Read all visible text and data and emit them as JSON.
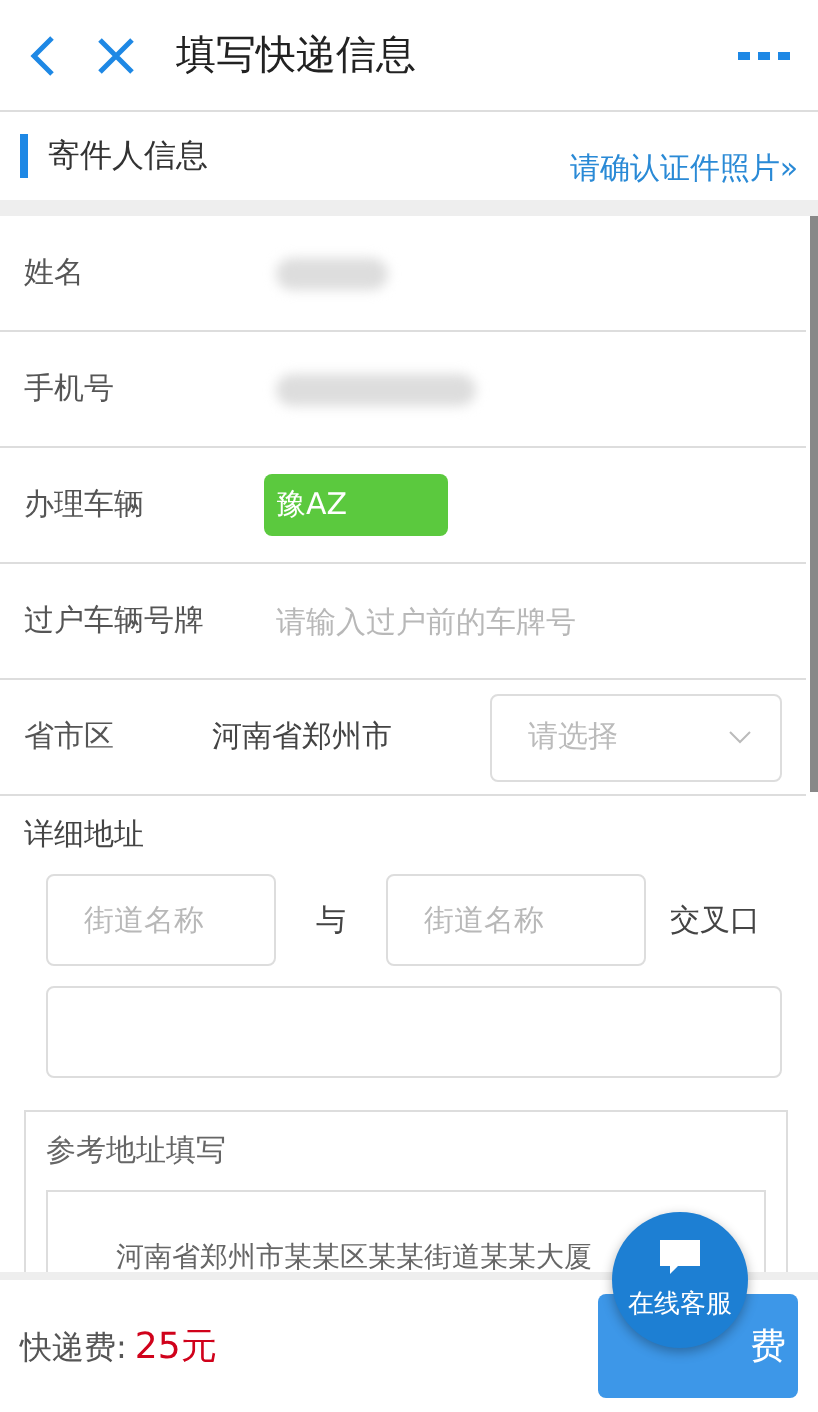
{
  "header": {
    "title": "填写快递信息"
  },
  "section": {
    "title": "寄件人信息",
    "link": "请确认证件照片»"
  },
  "fields": [
    {
      "kind": "blurred",
      "label": "姓名"
    },
    {
      "kind": "blurred",
      "label": "手机号"
    },
    {
      "kind": "plate",
      "label": "办理车辆",
      "value": "豫AZ"
    },
    {
      "kind": "input",
      "label": "过户车辆号牌",
      "placeholder": "请输入过户前的车牌号"
    },
    {
      "kind": "region",
      "label": "省市区",
      "value": "河南省郑州市",
      "placeholder": "请选择"
    }
  ],
  "address": {
    "label": "详细地址",
    "street_fields": [
      {
        "placeholder": "街道名称"
      },
      {
        "placeholder": "街道名称"
      }
    ],
    "joiner": "与",
    "suffix": "交叉口"
  },
  "reference": {
    "title": "参考地址填写",
    "example": "河南省郑州市某某区某某街道某某大厦"
  },
  "footer": {
    "fee_label": "快递费:",
    "fee": "25元",
    "pay_button": "费"
  },
  "chat_bubble": {
    "label": "在线客服"
  }
}
